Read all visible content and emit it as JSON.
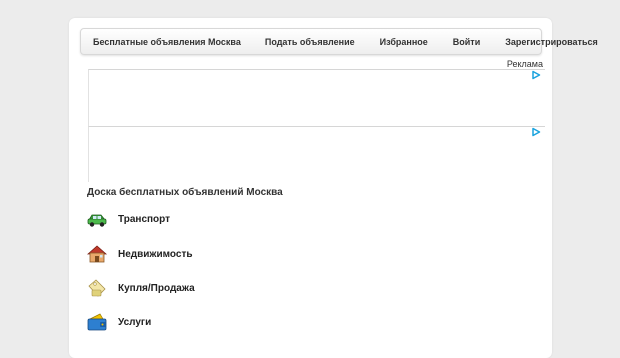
{
  "nav": {
    "items": [
      {
        "label": "Бесплатные объявления Москва"
      },
      {
        "label": "Подать объявление"
      },
      {
        "label": "Избранное"
      },
      {
        "label": "Войти"
      },
      {
        "label": "Зарегистрироваться"
      }
    ]
  },
  "ads": {
    "label": "Реклама"
  },
  "main": {
    "title": "Доска бесплатных объявлений Москва",
    "categories": [
      {
        "label": "Транспорт",
        "icon": "car-icon"
      },
      {
        "label": "Недвижимость",
        "icon": "house-icon"
      },
      {
        "label": "Купля/Продажа",
        "icon": "price-tag-icon"
      },
      {
        "label": "Услуги",
        "icon": "wallet-icon"
      }
    ]
  },
  "colors": {
    "background": "#ececec",
    "panel": "#ffffff",
    "adchoices": "#1aa3de"
  }
}
